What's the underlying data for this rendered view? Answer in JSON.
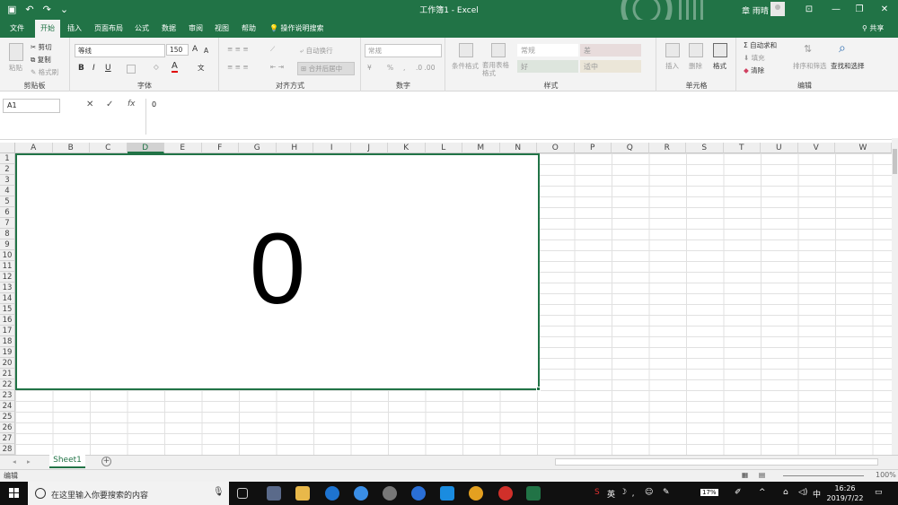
{
  "titlebar": {
    "title": "工作簿1 - Excel",
    "user": "章 雨晴",
    "undo": "↶",
    "redo": "↷",
    "save": "▣",
    "qat_more": "⌄",
    "options": "⊡",
    "minimize": "—",
    "restore": "❐",
    "close": "✕"
  },
  "tabs": [
    "文件",
    "开始",
    "插入",
    "页面布局",
    "公式",
    "数据",
    "审阅",
    "视图",
    "帮助"
  ],
  "active_tab": "开始",
  "tell_me": "操作说明搜索",
  "share": "共享",
  "ribbon": {
    "clipboard": {
      "label": "剪贴板",
      "paste": "粘贴",
      "cut": "剪切",
      "copy": "复制",
      "format_painter": "格式刷"
    },
    "font": {
      "label": "字体",
      "name": "等线",
      "size": "150",
      "bold": "B",
      "italic": "I",
      "underline": "U",
      "grow": "A",
      "shrink": "A",
      "color_a": "A",
      "wen": "文"
    },
    "alignment": {
      "label": "对齐方式",
      "wrap": "自动换行",
      "merge": "合并后居中"
    },
    "number": {
      "label": "数字",
      "format": "常规",
      "percent": "%"
    },
    "styles": {
      "label": "样式",
      "conditional": "条件格式",
      "table": "套用表格格式",
      "normal": "常规",
      "bad": "差",
      "good": "好",
      "neutral": "适中"
    },
    "cells": {
      "label": "单元格",
      "insert": "插入",
      "delete": "删除",
      "format": "格式"
    },
    "editing": {
      "label": "编辑",
      "autosum": "自动求和",
      "fill": "填充",
      "clear": "清除",
      "sort": "排序和筛选",
      "find": "查找和选择"
    }
  },
  "formula_bar": {
    "name_box": "A1",
    "cancel": "✕",
    "enter": "✓",
    "fx": "fx",
    "value": "0"
  },
  "columns": [
    "A",
    "B",
    "C",
    "D",
    "E",
    "F",
    "G",
    "H",
    "I",
    "J",
    "K",
    "L",
    "M",
    "N",
    "O",
    "P",
    "Q",
    "R",
    "S",
    "T",
    "U",
    "V",
    "W"
  ],
  "rows": [
    "1",
    "2",
    "3",
    "4",
    "5",
    "6",
    "7",
    "8",
    "9",
    "10",
    "11",
    "12",
    "13",
    "14",
    "15",
    "16",
    "17",
    "18",
    "19",
    "20",
    "21",
    "22",
    "23",
    "24",
    "25",
    "26",
    "27",
    "28"
  ],
  "cell_value": "0",
  "sheet_tab": "Sheet1",
  "add_sheet": "+",
  "status": {
    "mode": "编辑",
    "zoom": "100%"
  },
  "taskbar": {
    "search_placeholder": "在这里输入你要搜索的内容",
    "ime": "英",
    "time": "16:26",
    "date": "2019/7/22",
    "battery": "17%"
  }
}
